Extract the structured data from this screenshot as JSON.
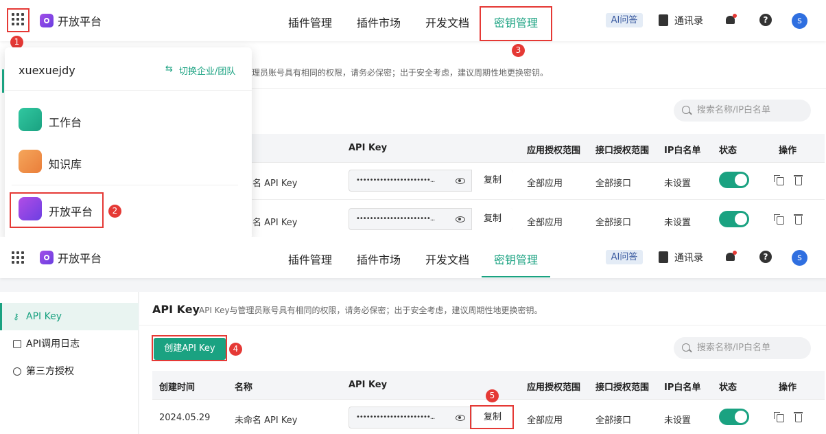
{
  "app": {
    "brand": "开放平台"
  },
  "nav": [
    "插件管理",
    "插件市场",
    "开发文档",
    "密钥管理"
  ],
  "header_right": {
    "ai": "AI问答",
    "contacts": "通讯录",
    "help": "?",
    "avatar": "s"
  },
  "dropdown": {
    "user": "xuexuejdy",
    "switch": "切换企业/团队",
    "apps": [
      "工作台",
      "知识库",
      "开放平台"
    ]
  },
  "sidebar": {
    "items": [
      "API Key",
      "API调用日志",
      "第三方授权"
    ]
  },
  "page": {
    "title": "API Key",
    "notice": "API Key与管理员账号具有相同的权限，请务必保密；出于安全考虑，建议周期性地更换密钥。",
    "notice_partial": "理员账号具有相同的权限，请务必保密；出于安全考虑，建议周期性地更换密钥。",
    "create_button": "创建API Key",
    "search_placeholder": "搜索名称/IP白名单"
  },
  "table": {
    "columns": [
      "创建时间",
      "名称",
      "API Key",
      "应用授权范围",
      "接口授权范围",
      "IP白名单",
      "状态",
      "操作"
    ],
    "rows": [
      {
        "created": "2024.05.29",
        "name": "未命名 API Key",
        "name_partial": "名 API Key",
        "key": "••••••••••••••••••••••...",
        "copy": "复制",
        "app_scope": "全部应用",
        "api_scope": "全部接口",
        "ip": "未设置",
        "enabled": true
      }
    ]
  },
  "badges": [
    "1",
    "2",
    "3",
    "4",
    "5"
  ],
  "colors": {
    "accent": "#1aa281",
    "highlight": "#e53935",
    "brand_purple": "#8a46e6"
  },
  "icons": [
    "apps-grid-icon",
    "platform-logo-icon",
    "contacts-book-icon",
    "bell-icon",
    "help-icon",
    "switch-icon",
    "eye-icon",
    "copy-icon",
    "delete-icon",
    "key-icon",
    "log-icon",
    "auth-icon"
  ]
}
